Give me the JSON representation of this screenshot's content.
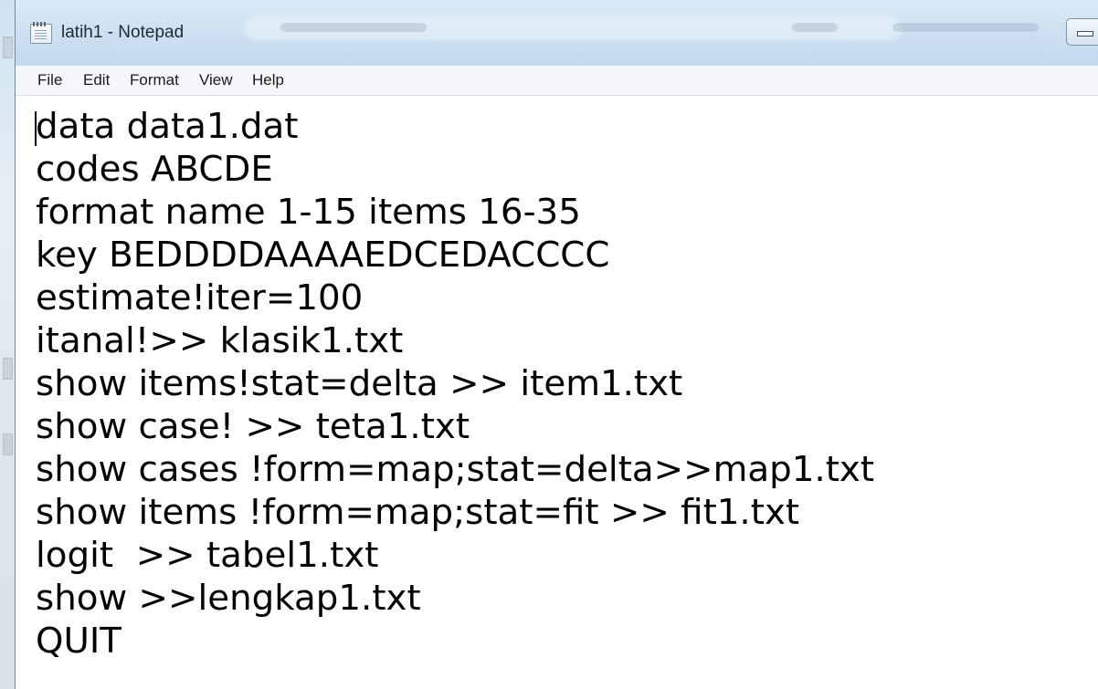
{
  "window": {
    "title": "latih1 - Notepad"
  },
  "menu": [
    "File",
    "Edit",
    "Format",
    "View",
    "Help"
  ],
  "editor": {
    "lines": [
      "data data1.dat",
      "codes ABCDE",
      "format name 1-15 items 16-35",
      "key BEDDDDAAAAEDCEDACCCC",
      "estimate!iter=100",
      "itanal!>> klasik1.txt",
      "show items!stat=delta >> item1.txt",
      "show case! >> teta1.txt",
      "show cases !form=map;stat=delta>>map1.txt",
      "show items !form=map;stat=fit >> fit1.txt",
      "logit  >> tabel1.txt",
      "show >>lengkap1.txt",
      "QUIT"
    ]
  }
}
